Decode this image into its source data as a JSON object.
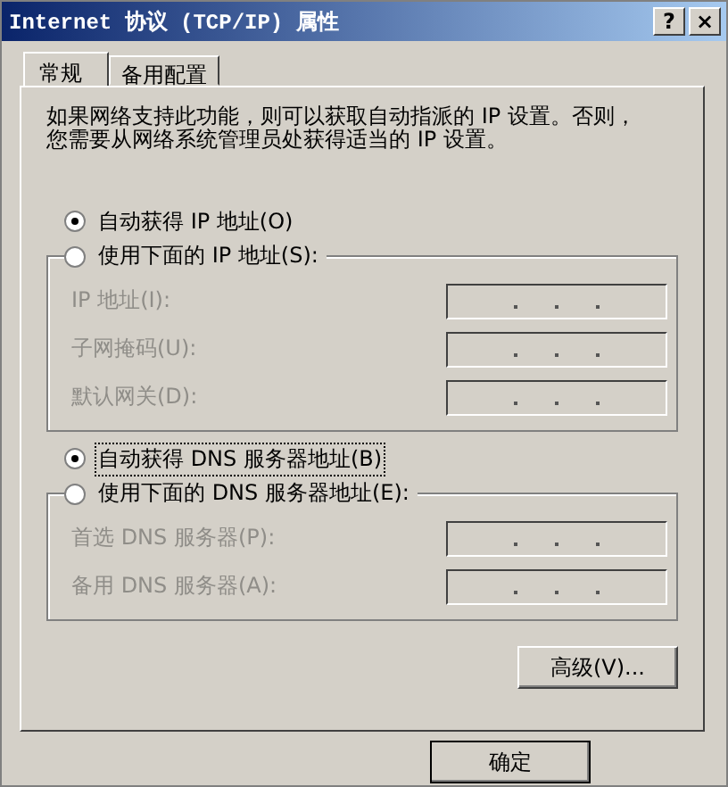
{
  "window": {
    "title": "Internet 协议 (TCP/IP) 属性",
    "help_button": "?",
    "close_button": "×"
  },
  "tabs": [
    {
      "label": "常规",
      "selected": true
    },
    {
      "label": "备用配置",
      "selected": false
    }
  ],
  "description": [
    "如果网络支持此功能，则可以获取自动指派的 IP 设置。否则，",
    "您需要从网络系统管理员处获得适当的 IP 设置。"
  ],
  "sections": [
    {
      "auto_radio": {
        "label": "自动获得 IP 地址(O)",
        "selected": true,
        "focused": false
      },
      "manual_radio": {
        "label": "使用下面的 IP 地址(S):",
        "selected": false
      },
      "fields": [
        {
          "label": "IP 地址(I):",
          "disabled": true
        },
        {
          "label": "子网掩码(U):",
          "disabled": true
        },
        {
          "label": "默认网关(D):",
          "disabled": true
        }
      ]
    },
    {
      "auto_radio": {
        "label": "自动获得 DNS 服务器地址(B)",
        "selected": true,
        "focused": true
      },
      "manual_radio": {
        "label": "使用下面的 DNS 服务器地址(E):",
        "selected": false
      },
      "fields": [
        {
          "label": "首选 DNS 服务器(P):",
          "disabled": true
        },
        {
          "label": "备用 DNS 服务器(A):",
          "disabled": true
        }
      ]
    }
  ],
  "advanced_button": "高级(V)...",
  "ok_button": "确定"
}
